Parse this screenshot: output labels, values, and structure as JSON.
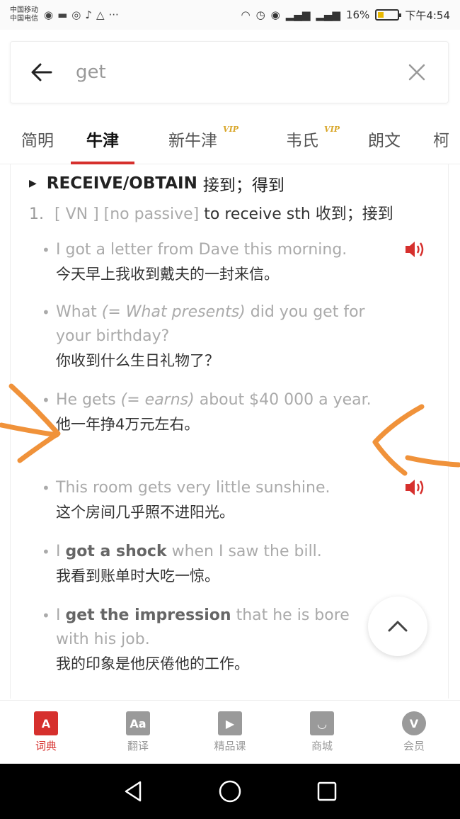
{
  "status_bar": {
    "carrier1": "中国移动",
    "carrier2": "中国电信",
    "battery": "16%",
    "time": "下午4:54"
  },
  "search": {
    "query": "get"
  },
  "tabs": [
    {
      "label": "简明",
      "vip": ""
    },
    {
      "label": "牛津",
      "vip": ""
    },
    {
      "label": "新牛津",
      "vip": "VIP"
    },
    {
      "label": "韦氏",
      "vip": "VIP"
    },
    {
      "label": "朗文",
      "vip": ""
    },
    {
      "label": "柯",
      "vip": ""
    }
  ],
  "entry": {
    "sense_title": "RECEIVE/OBTAIN",
    "sense_title_zh": "接到；得到",
    "def_number": "1.",
    "def_grammar": "[ VN ] [no passive]",
    "def_text": "to receive sth 收到；接到",
    "examples": [
      {
        "en_1": "I got a letter from Dave this morning.",
        "zh": "今天早上我收到戴夫的一封来信。"
      },
      {
        "en_1": "What ",
        "en_italic": "(= What presents)",
        "en_2": " did you get for your birthday?",
        "zh": "你收到什么生日礼物了？"
      },
      {
        "en_1": "He gets ",
        "en_italic": "(= earns)",
        "en_2": " about $40 000 a year.",
        "zh": "他一年挣4万元左右。"
      },
      {
        "en_1": "This room gets very little sunshine.",
        "zh": "这个房间几乎照不进阳光。"
      },
      {
        "en_1": "I ",
        "en_bold": "got a shock",
        "en_2": " when I saw the bill.",
        "zh": "我看到账单时大吃一惊。"
      },
      {
        "en_1": "I ",
        "en_bold": "get the impression",
        "en_2": " that he is bore",
        "en_3": "with his job.",
        "zh": "我的印象是他厌倦他的工作。"
      }
    ]
  },
  "bottom_nav": [
    {
      "label": "词典",
      "icon_text": "A"
    },
    {
      "label": "翻译",
      "icon_text": "Aa"
    },
    {
      "label": "精品课",
      "icon_text": "▶"
    },
    {
      "label": "商城",
      "icon_text": "◡"
    },
    {
      "label": "会员",
      "icon_text": "V"
    }
  ],
  "colors": {
    "accent": "#d6302d",
    "vip": "#d9a72b",
    "annotation": "#f0923a"
  }
}
